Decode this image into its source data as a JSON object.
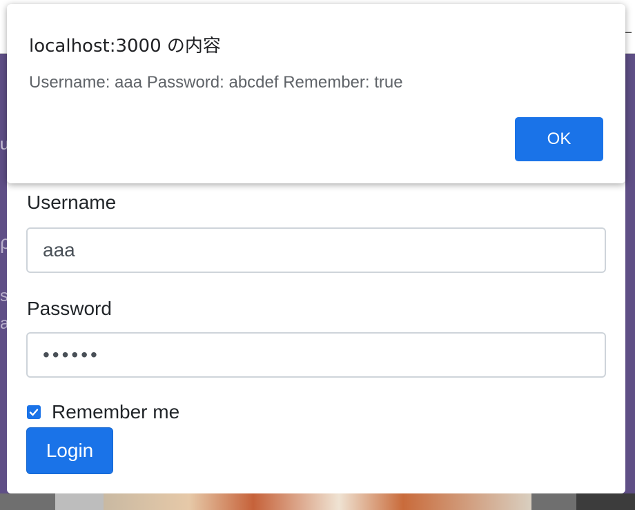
{
  "dialog": {
    "title": "localhost:3000 の内容",
    "message": "Username: aaa Password: abcdef Remember: true",
    "ok_label": "OK"
  },
  "form": {
    "username_label": "Username",
    "username_value": "aaa",
    "password_label": "Password",
    "password_value": "••••••",
    "remember_label": "Remember me",
    "remember_checked": true,
    "login_label": "Login"
  },
  "background": {
    "top_fragment": "—",
    "frag_u": "u",
    "frag_s": "s",
    "frag_a": "a",
    "frag_p": "ρ"
  },
  "colors": {
    "accent": "#1a73e8",
    "backdrop": "#5f4f86"
  }
}
